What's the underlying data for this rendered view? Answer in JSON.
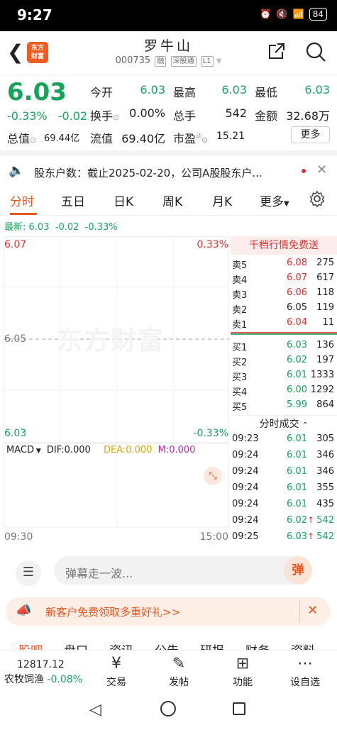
{
  "status_bar": {
    "time": "9:27",
    "battery": "84"
  },
  "header": {
    "stock_name": "罗牛山",
    "stock_code": "000735",
    "tags": [
      "融",
      "深股通",
      "L1"
    ],
    "logo_text_line1": "东方",
    "logo_text_line2": "财富"
  },
  "quote": {
    "price": "6.03",
    "change_pct": "-0.33%",
    "change_abs": "-0.02",
    "open_label": "今开",
    "open": "6.03",
    "high_label": "最高",
    "high": "6.03",
    "low_label": "最低",
    "low": "6.03",
    "turnover_label": "换手",
    "turnover": "0.00%",
    "volume_label": "总手",
    "volume": "542",
    "amount_label": "金额",
    "amount": "32.68万",
    "mktcap_label": "总值",
    "mktcap": "69.44亿",
    "float_label": "流值",
    "float_cap": "69.40亿",
    "pe_label": "市盈",
    "pe_sup": "动",
    "pe": "15.21",
    "more_label": "更多"
  },
  "notice": {
    "text": "股东户数：截止2025-02-20，公司A股股东户..."
  },
  "tabs": [
    "分时",
    "五日",
    "日K",
    "周K",
    "月K",
    "更多"
  ],
  "latest": {
    "label": "最新:",
    "price": "6.03",
    "change": "-0.02",
    "pct": "-0.33%"
  },
  "chart": {
    "top_price": "6.07",
    "top_pct": "0.33%",
    "mid_price": "6.05",
    "bottom_price": "6.03",
    "bottom_pct": "-0.33%",
    "watermark": "东方财富",
    "macd_label": "MACD",
    "dif": "DIF:0.000",
    "dea": "DEA:0.000",
    "m": "M:0.000",
    "time_start": "09:30",
    "time_end": "15:00"
  },
  "orderbook": {
    "header": "千档行情免费送",
    "asks": [
      {
        "label": "卖5",
        "price": "6.08",
        "vol": "275",
        "color": "red"
      },
      {
        "label": "卖4",
        "price": "6.07",
        "vol": "617",
        "color": "red"
      },
      {
        "label": "卖3",
        "price": "6.06",
        "vol": "118",
        "color": "red"
      },
      {
        "label": "卖2",
        "price": "6.05",
        "vol": "119",
        "color": "black"
      },
      {
        "label": "卖1",
        "price": "6.04",
        "vol": "11",
        "color": "red"
      }
    ],
    "bids": [
      {
        "label": "买1",
        "price": "6.03",
        "vol": "136",
        "color": "green"
      },
      {
        "label": "买2",
        "price": "6.02",
        "vol": "197",
        "color": "green"
      },
      {
        "label": "买3",
        "price": "6.01",
        "vol": "1333",
        "color": "green"
      },
      {
        "label": "买4",
        "price": "6.00",
        "vol": "1292",
        "color": "green"
      },
      {
        "label": "买5",
        "price": "5.99",
        "vol": "864",
        "color": "green"
      }
    ],
    "trades_header": "分时成交",
    "trades": [
      {
        "time": "09:23",
        "price": "6.01",
        "arrow": "",
        "vol": "305"
      },
      {
        "time": "09:24",
        "price": "6.01",
        "arrow": "",
        "vol": "346"
      },
      {
        "time": "09:24",
        "price": "6.01",
        "arrow": "",
        "vol": "346"
      },
      {
        "time": "09:24",
        "price": "6.01",
        "arrow": "",
        "vol": "355"
      },
      {
        "time": "09:24",
        "price": "6.01",
        "arrow": "",
        "vol": "435"
      },
      {
        "time": "09:24",
        "price": "6.02",
        "arrow": "↑",
        "vol": "542"
      },
      {
        "time": "09:25",
        "price": "6.03",
        "arrow": "↑",
        "vol": "542"
      }
    ]
  },
  "comment": {
    "placeholder": "弹幕走一波...",
    "btn": "弹"
  },
  "promo": {
    "text": "新客户免费领取多重好礼>>"
  },
  "subtabs": [
    "股吧",
    "盘口",
    "资讯",
    "公告",
    "研报",
    "财务",
    "资料"
  ],
  "bottom_nav": {
    "index_value": "12817.12",
    "index_name": "农牧饲渔",
    "index_change": "-0.08%",
    "items": [
      {
        "label": "交易"
      },
      {
        "label": "发帖"
      },
      {
        "label": "功能"
      },
      {
        "label": "设自选"
      }
    ]
  },
  "colors": {
    "up": "#e03030",
    "down": "#16a35a",
    "accent": "#e8541e"
  }
}
